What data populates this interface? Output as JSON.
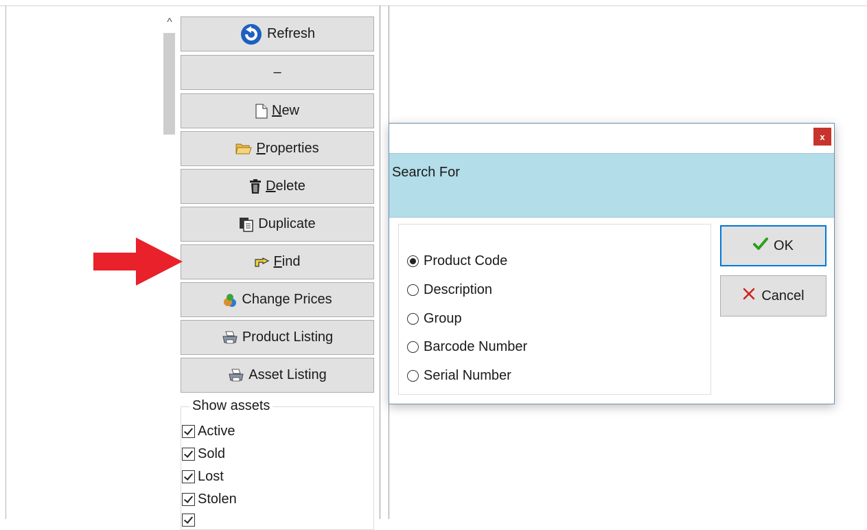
{
  "toolbar": {
    "refresh": "Refresh",
    "separator": "–",
    "new_prefix": "",
    "new_u": "N",
    "new_rest": "ew",
    "properties_u": "P",
    "properties_rest": "roperties",
    "delete_u": "D",
    "delete_rest": "elete",
    "duplicate": "Duplicate",
    "find_u": "F",
    "find_rest": "ind",
    "change_prices": "Change Prices",
    "product_listing": "Product Listing",
    "asset_listing": "Asset Listing"
  },
  "show_assets": {
    "legend": "Show assets",
    "items": [
      "Active",
      "Sold",
      "Lost",
      "Stolen"
    ]
  },
  "dialog": {
    "close": "x",
    "header": "Search For",
    "options": [
      "Product Code",
      "Description",
      "Group",
      "Barcode Number",
      "Serial Number"
    ],
    "selected": "Product Code",
    "ok": "OK",
    "cancel": "Cancel"
  },
  "colors": {
    "arrow": "#e8212a",
    "header_bg": "#b3dde9",
    "close_bg": "#c7342b",
    "ok_check": "#2e9d1e",
    "cancel_x": "#d0201c"
  },
  "icons": {
    "refresh": "refresh-icon",
    "new": "new-document-icon",
    "properties": "folder-open-icon",
    "delete": "trash-icon",
    "duplicate": "duplicate-icon",
    "find": "pointing-hand-icon",
    "change_prices": "money-bag-icon",
    "product_listing": "printer-icon",
    "asset_listing": "printer-icon",
    "ok": "checkmark-icon",
    "cancel": "x-icon"
  }
}
